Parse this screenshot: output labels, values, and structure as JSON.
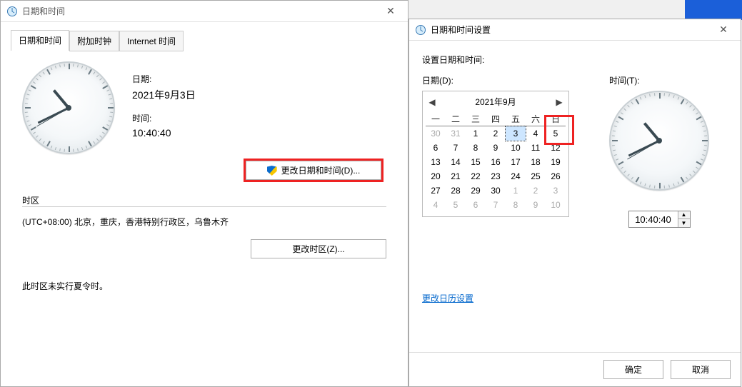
{
  "leftDialog": {
    "title": "日期和时间",
    "tabs": {
      "main": "日期和时间",
      "extra": "附加时钟",
      "internet": "Internet 时间"
    },
    "dateLabel": "日期:",
    "dateValue": "2021年9月3日",
    "timeLabel": "时间:",
    "timeValue": "10:40:40",
    "changeDateTimeBtn": "更改日期和时间(D)...",
    "tzHeader": "时区",
    "tzValue": "(UTC+08:00) 北京，重庆，香港特别行政区，乌鲁木齐",
    "changeTzBtn": "更改时区(Z)...",
    "dstNote": "此时区未实行夏令时。"
  },
  "rightDialog": {
    "title": "日期和时间设置",
    "heading": "设置日期和时间:",
    "dateLbl": "日期(D):",
    "timeLbl": "时间(T):",
    "calendarLink": "更改日历设置",
    "okBtn": "确定",
    "cancelBtn": "取消",
    "timeValue": "10:40:40",
    "calendar": {
      "monthTitle": "2021年9月",
      "weekdays": [
        "一",
        "二",
        "三",
        "四",
        "五",
        "六",
        "日"
      ],
      "rows": [
        [
          {
            "n": 30,
            "dim": true
          },
          {
            "n": 31,
            "dim": true
          },
          {
            "n": 1
          },
          {
            "n": 2
          },
          {
            "n": 3,
            "sel": true
          },
          {
            "n": 4
          },
          {
            "n": 5,
            "red": true
          }
        ],
        [
          {
            "n": 6
          },
          {
            "n": 7
          },
          {
            "n": 8
          },
          {
            "n": 9
          },
          {
            "n": 10
          },
          {
            "n": 11
          },
          {
            "n": 12
          }
        ],
        [
          {
            "n": 13
          },
          {
            "n": 14
          },
          {
            "n": 15
          },
          {
            "n": 16
          },
          {
            "n": 17
          },
          {
            "n": 18
          },
          {
            "n": 19
          }
        ],
        [
          {
            "n": 20
          },
          {
            "n": 21
          },
          {
            "n": 22
          },
          {
            "n": 23
          },
          {
            "n": 24
          },
          {
            "n": 25
          },
          {
            "n": 26
          }
        ],
        [
          {
            "n": 27
          },
          {
            "n": 28
          },
          {
            "n": 29
          },
          {
            "n": 30
          },
          {
            "n": 1,
            "dim": true
          },
          {
            "n": 2,
            "dim": true
          },
          {
            "n": 3,
            "dim": true
          }
        ],
        [
          {
            "n": 4,
            "dim": true
          },
          {
            "n": 5,
            "dim": true
          },
          {
            "n": 6,
            "dim": true
          },
          {
            "n": 7,
            "dim": true
          },
          {
            "n": 8,
            "dim": true
          },
          {
            "n": 9,
            "dim": true
          },
          {
            "n": 10,
            "dim": true
          }
        ]
      ]
    }
  },
  "clock": {
    "hours": 10,
    "minutes": 40,
    "seconds": 40
  }
}
